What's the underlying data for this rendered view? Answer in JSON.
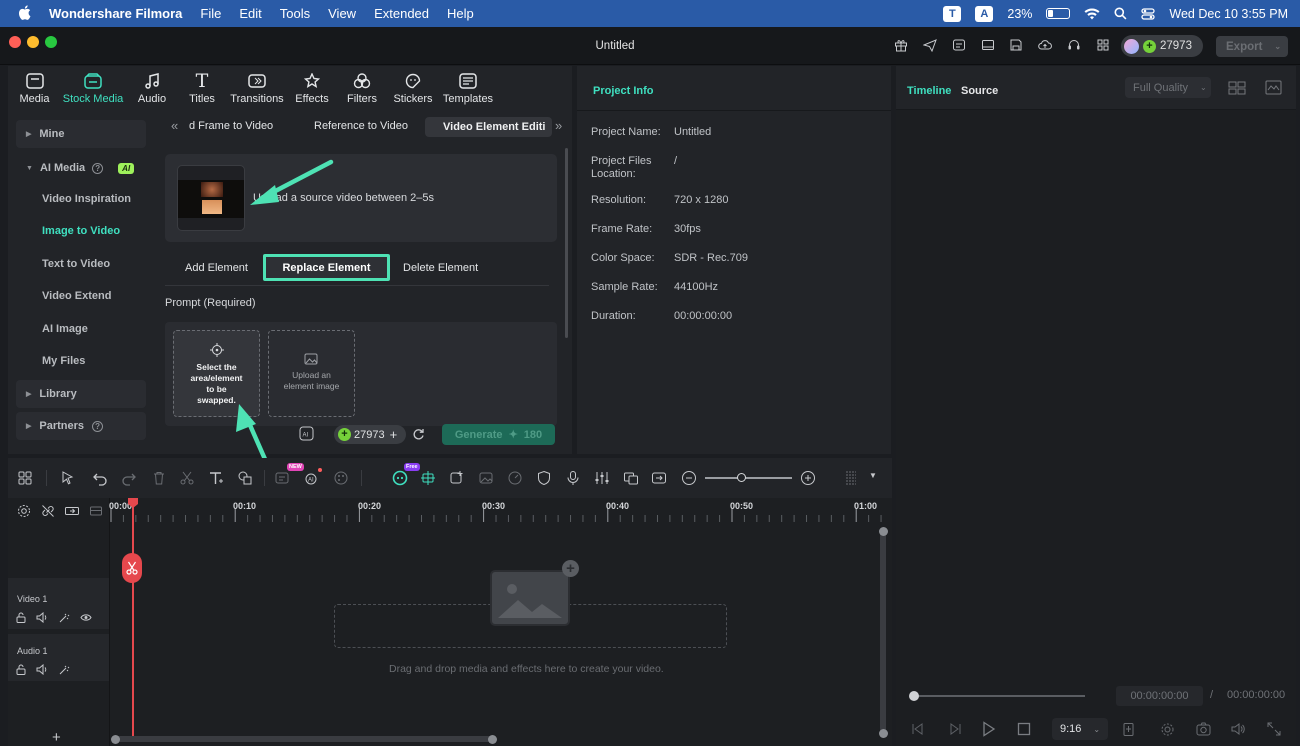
{
  "menubar": {
    "app_name": "Wondershare Filmora",
    "items": [
      "File",
      "Edit",
      "Tools",
      "View",
      "Extended",
      "Help"
    ],
    "battery": "23%",
    "kbd1": "T",
    "kbd2": "A",
    "datetime": "Wed Dec 10  3:55 PM"
  },
  "window": {
    "title": "Untitled",
    "credits": "27973",
    "export_label": "Export"
  },
  "media_tabs": [
    {
      "label": "Media",
      "icon": "media-icon"
    },
    {
      "label": "Stock Media",
      "icon": "stock-media-icon"
    },
    {
      "label": "Audio",
      "icon": "audio-icon"
    },
    {
      "label": "Titles",
      "icon": "titles-icon"
    },
    {
      "label": "Transitions",
      "icon": "transitions-icon"
    },
    {
      "label": "Effects",
      "icon": "effects-icon"
    },
    {
      "label": "Filters",
      "icon": "filters-icon"
    },
    {
      "label": "Stickers",
      "icon": "stickers-icon"
    },
    {
      "label": "Templates",
      "icon": "templates-icon"
    }
  ],
  "sidebar": {
    "mine": "Mine",
    "ai_media": "AI Media",
    "ai_badge": "AI",
    "items": [
      "Video Inspiration",
      "Image to Video",
      "Text to Video",
      "Video Extend",
      "AI Image",
      "My Files"
    ],
    "library": "Library",
    "partners": "Partners"
  },
  "content": {
    "subtabs": [
      "d Frame to Video",
      "Reference to Video",
      "Video Element Editi"
    ],
    "upload_text": "Upload a source video between 2–5s",
    "element_buttons": [
      "Add Element",
      "Replace Element",
      "Delete Element"
    ],
    "prompt_label": "Prompt (Required)",
    "select_area_text": "Select the area/element to be swapped.",
    "upload_element_text": "Upload an element image",
    "credits": "27973",
    "generate_label": "Generate",
    "generate_cost": "180"
  },
  "project_info": {
    "title": "Project Info",
    "rows": [
      {
        "label": "Project Name:",
        "value": "Untitled"
      },
      {
        "label": "Project Files Location:",
        "value": "/"
      },
      {
        "label": "Resolution:",
        "value": "720 x 1280"
      },
      {
        "label": "Frame Rate:",
        "value": "30fps"
      },
      {
        "label": "Color Space:",
        "value": "SDR - Rec.709"
      },
      {
        "label": "Sample Rate:",
        "value": "44100Hz"
      },
      {
        "label": "Duration:",
        "value": "00:00:00:00"
      }
    ]
  },
  "preview": {
    "tab_timeline": "Timeline",
    "tab_source": "Source",
    "quality": "Full Quality",
    "current_time": "00:00:00:00",
    "separator": "/",
    "total_time": "00:00:00:00",
    "aspect": "9:16"
  },
  "timeline": {
    "ruler": [
      "00:00",
      "00:10",
      "00:20",
      "00:30",
      "00:40",
      "00:50",
      "01:00"
    ],
    "video_track": "Video 1",
    "audio_track": "Audio 1",
    "drop_hint": "Drag and drop media and effects here to create your video.",
    "badge_new": "NEW",
    "badge_free": "Free",
    "add_track": "+"
  },
  "colors": {
    "accent": "#3fe0c0",
    "menubar": "#2a5ba7",
    "annotation": "#4ee2b4",
    "playhead": "#e5484d"
  }
}
